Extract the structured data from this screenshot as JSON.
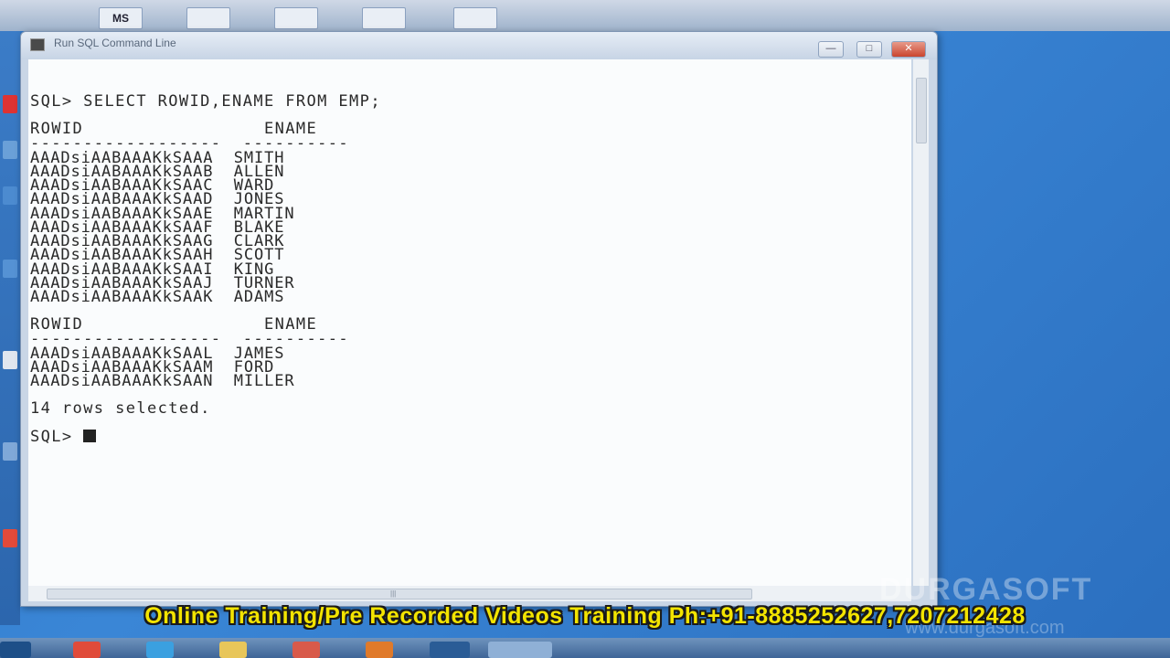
{
  "window": {
    "title": "Run SQL Command Line",
    "minimize_label": "—",
    "maximize_label": "□",
    "close_label": "✕"
  },
  "console": {
    "command_line": "SQL> SELECT ROWID,ENAME FROM EMP;",
    "header1": "ROWID                 ENAME",
    "separator1": "------------------  ----------",
    "rows1": [
      "AAADsiAABAAAKkSAAA  SMITH",
      "AAADsiAABAAAKkSAAB  ALLEN",
      "AAADsiAABAAAKkSAAC  WARD",
      "AAADsiAABAAAKkSAAD  JONES",
      "AAADsiAABAAAKkSAAE  MARTIN",
      "AAADsiAABAAAKkSAAF  BLAKE",
      "AAADsiAABAAAKkSAAG  CLARK",
      "AAADsiAABAAAKkSAAH  SCOTT",
      "AAADsiAABAAAKkSAAI  KING",
      "AAADsiAABAAAKkSAAJ  TURNER",
      "AAADsiAABAAAKkSAAK  ADAMS"
    ],
    "header2": "ROWID                 ENAME",
    "separator2": "------------------  ----------",
    "rows2": [
      "AAADsiAABAAAKkSAAL  JAMES",
      "AAADsiAABAAAKkSAAM  FORD",
      "AAADsiAABAAAKkSAAN  MILLER"
    ],
    "summary": "14 rows selected.",
    "prompt": "SQL> "
  },
  "top_strip": {
    "ms_label": "MS"
  },
  "watermark": {
    "brand": "DURGASOFT",
    "url": "www.durgasoft.com"
  },
  "banner": {
    "text": "Online Training/Pre Recorded Videos Training Ph:+91-8885252627,7207212428"
  }
}
